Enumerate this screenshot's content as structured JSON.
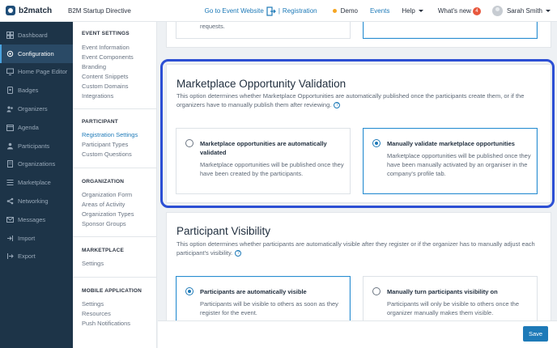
{
  "app": {
    "logo": "b2match",
    "event_title": "B2M Startup Directive"
  },
  "topnav": {
    "goto_event": "Go to Event Website",
    "separator": "|",
    "registration": "Registration",
    "demo": "Demo",
    "events": "Events",
    "help": "Help",
    "whats_new": "What's new",
    "whats_new_count": "4",
    "user_name": "Sarah Smith"
  },
  "sidebar": {
    "items": [
      {
        "label": "Dashboard",
        "icon": "dashboard-icon"
      },
      {
        "label": "Configuration",
        "icon": "gear-icon"
      },
      {
        "label": "Home Page Editor",
        "icon": "monitor-icon"
      },
      {
        "label": "Badges",
        "icon": "badge-icon"
      },
      {
        "label": "Organizers",
        "icon": "people-icon"
      },
      {
        "label": "Agenda",
        "icon": "calendar-icon"
      },
      {
        "label": "Participants",
        "icon": "person-icon"
      },
      {
        "label": "Organizations",
        "icon": "building-icon"
      },
      {
        "label": "Marketplace",
        "icon": "list-icon"
      },
      {
        "label": "Networking",
        "icon": "network-icon"
      },
      {
        "label": "Messages",
        "icon": "mail-icon"
      },
      {
        "label": "Import",
        "icon": "import-icon"
      },
      {
        "label": "Export",
        "icon": "export-icon"
      }
    ]
  },
  "submenu": {
    "event_settings": {
      "title": "EVENT SETTINGS",
      "items": [
        "Event Information",
        "Event Components",
        "Branding",
        "Content Snippets",
        "Custom Domains",
        "Integrations"
      ]
    },
    "participant": {
      "title": "PARTICIPANT",
      "items": [
        "Registration Settings",
        "Participant Types",
        "Custom Questions"
      ]
    },
    "organization": {
      "title": "ORGANIZATION",
      "items": [
        "Organization Form",
        "Areas of Activity",
        "Organization Types",
        "Sponsor Groups"
      ]
    },
    "marketplace": {
      "title": "MARKETPLACE",
      "items": [
        "Settings"
      ]
    },
    "mobile": {
      "title": "MOBILE APPLICATION",
      "items": [
        "Settings",
        "Resources",
        "Push Notifications"
      ]
    }
  },
  "main": {
    "top_partial": {
      "desc_tail": "requests."
    },
    "marketplace": {
      "title": "Marketplace Opportunity Validation",
      "description": "This option determines whether Marketplace Opportunities are automatically published once the participants create them, or if the organizers have to manually publish them after reviewing.",
      "options": [
        {
          "title": "Marketplace opportunities are automatically validated",
          "desc": "Marketplace opportunities will be published once they have been created by the participants."
        },
        {
          "title": "Manually validate marketplace opportunities",
          "desc": "Marketplace opportunities will be published once they have been manually activated by an organiser in the company's profile tab."
        }
      ]
    },
    "visibility": {
      "title": "Participant Visibility",
      "description": "This option determines whether participants are automatically visible after they register or if the organizer has to manually adjust each participant's visibility.",
      "options": [
        {
          "title": "Participants are automatically visible",
          "desc": "Participants will be visible to others as soon as they register for the event."
        },
        {
          "title": "Manually turn participants visibility on",
          "desc": "Participants will only be visible to others once the organizer manually makes them visible."
        }
      ]
    }
  },
  "footer": {
    "save": "Save"
  },
  "colors": {
    "accent": "#1e7ab8",
    "sidebar": "#1d3448",
    "highlight": "#2c4fd4"
  }
}
